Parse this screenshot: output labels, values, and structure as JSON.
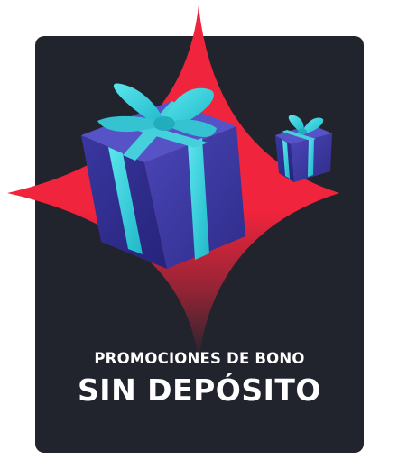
{
  "promo": {
    "subtitle": "PROMOCIONES DE BONO",
    "title": "SIN DEPÓSITO"
  },
  "graphics": {
    "background_icon": "red-four-point-star",
    "main_icon": "gift-box-icon",
    "secondary_icon": "small-gift-box-icon"
  },
  "colors": {
    "card": "#22242d",
    "star_red": "#f0243c",
    "box_purple": "#3d3aa3",
    "ribbon_cyan": "#2fd6e2",
    "text": "#ffffff"
  }
}
